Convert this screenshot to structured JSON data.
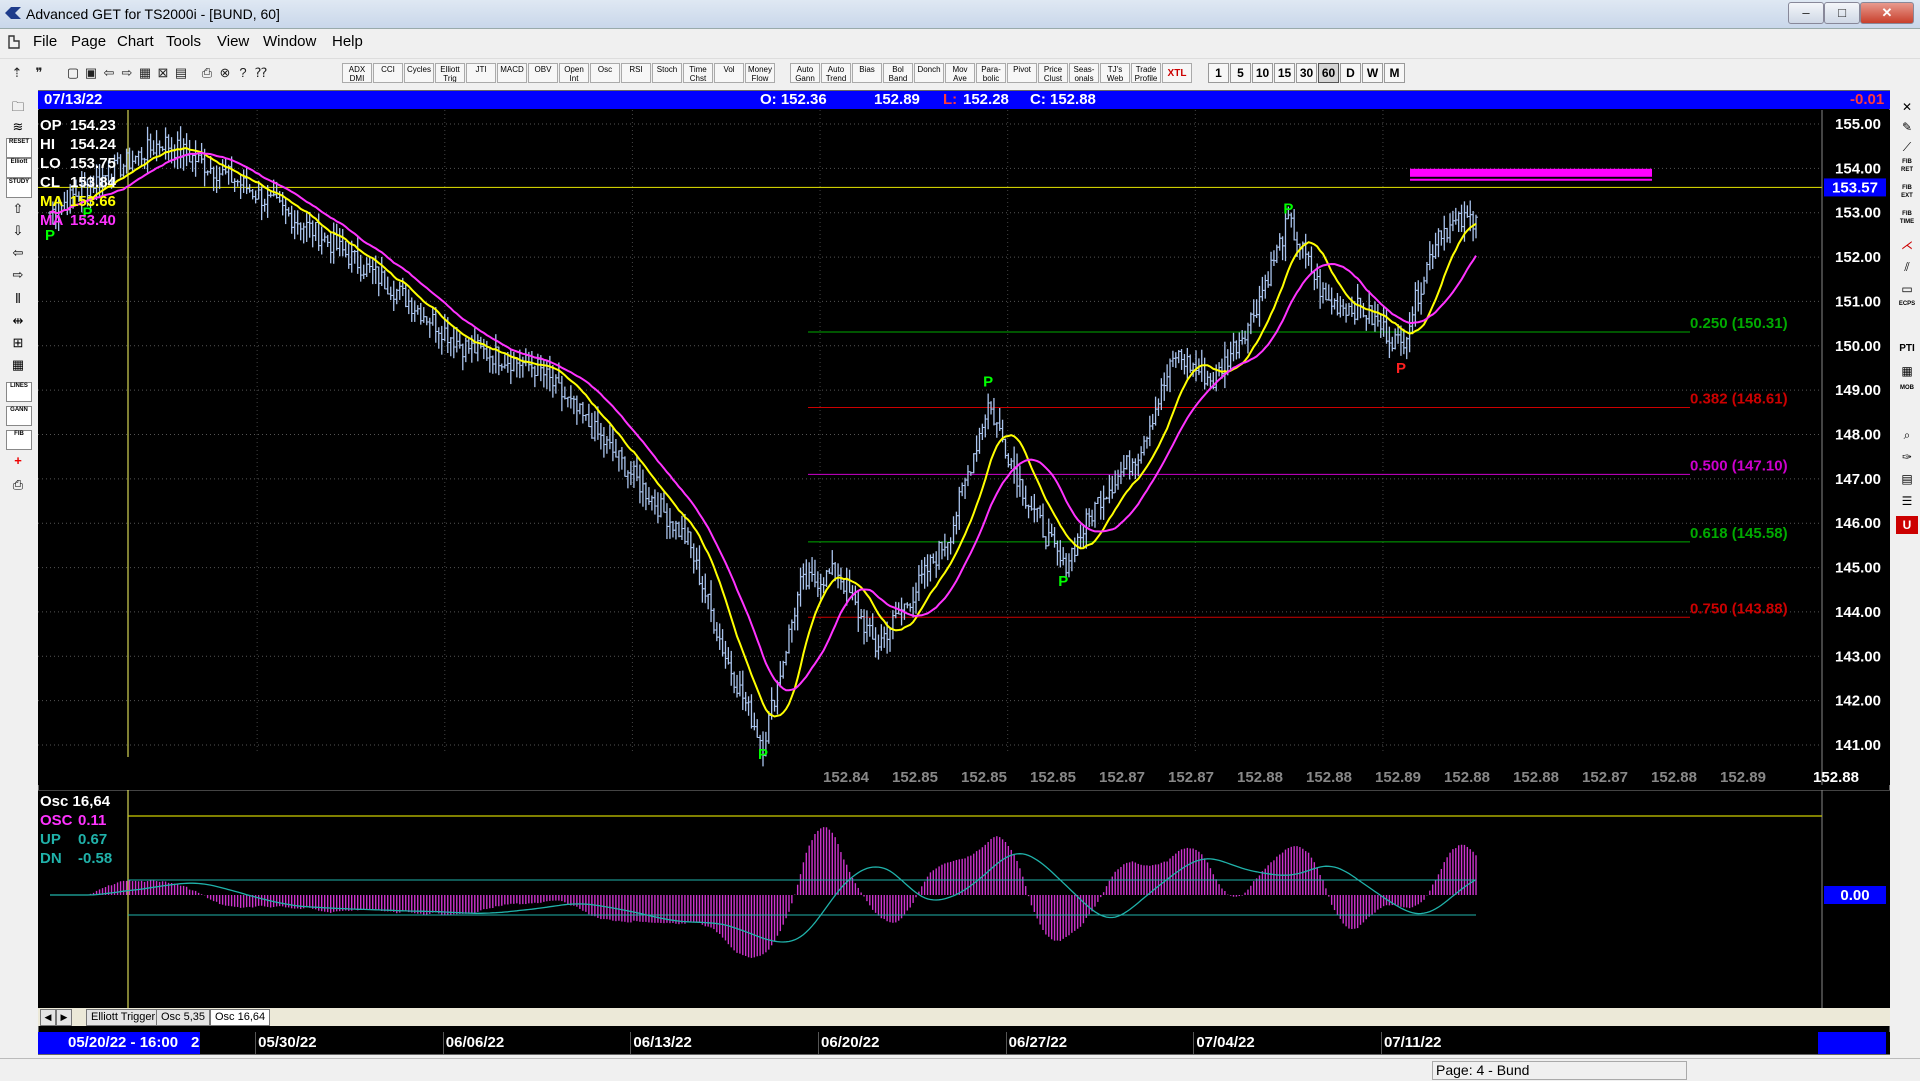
{
  "window": {
    "title": "Advanced GET for TS2000i - [BUND, 60]",
    "min": "–",
    "max": "□",
    "close": "✕"
  },
  "menu": [
    "File",
    "Page",
    "Chart",
    "Tools",
    "View",
    "Window",
    "Help"
  ],
  "toolbar": {
    "study_buttons": [
      "ADX DMI",
      "CCI",
      "Cycles",
      "Elliott Trig",
      "JTI",
      "MACD",
      "OBV",
      "Open Int",
      "Osc",
      "RSI",
      "Stoch",
      "Time Chst",
      "Vol",
      "Money Flow"
    ],
    "tool_buttons": [
      "Auto Gann",
      "Auto Trend",
      "Bias",
      "Bol Band",
      "Donch",
      "Mov Ave",
      "Para-bolic",
      "Pivot",
      "Price Clust",
      "Seas-onals",
      "TJ's Web",
      "Trade Profile",
      "XTL"
    ],
    "timeframes": [
      "1",
      "5",
      "10",
      "15",
      "30",
      "60",
      "D",
      "W",
      "M"
    ],
    "selected_timeframe": "60"
  },
  "left_tools": [
    "RESET",
    "Elliott",
    "STUDY",
    "LINES",
    "GANN",
    "FIB"
  ],
  "right_tools": [
    "FIB RET",
    "FIB EXT",
    "FIB TIME",
    "ECPS",
    "PTI",
    "MOB"
  ],
  "infobar": {
    "date": "07/13/22",
    "open": "O: 152.36",
    "high": "152.89",
    "low_label": "L:",
    "low": "152.28",
    "close": "C: 152.88",
    "change": "-0.01"
  },
  "legend": [
    {
      "label": "OP",
      "value": "154.23",
      "color": "#ffffff"
    },
    {
      "label": "HI",
      "value": "154.24",
      "color": "#ffffff"
    },
    {
      "label": "LO",
      "value": "153.75",
      "color": "#ffffff"
    },
    {
      "label": "CL",
      "value": "153.84",
      "color": "#ffffff"
    },
    {
      "label": "MA",
      "value": "153.66",
      "color": "#ffff00"
    },
    {
      "label": "MA",
      "value": "153.40",
      "color": "#ff33ff"
    }
  ],
  "osc_legend": [
    {
      "label": "Osc 16,64",
      "value": "",
      "color": "#ffffff"
    },
    {
      "label": "OSC",
      "value": "0.11",
      "color": "#ff33ff"
    },
    {
      "label": "UP",
      "value": "0.67",
      "color": "#20b2aa"
    },
    {
      "label": "DN",
      "value": "-0.58",
      "color": "#20b2aa"
    }
  ],
  "chart_data": {
    "type": "candlestick",
    "price_axis": {
      "min": 141.0,
      "max": 155.0,
      "ticks": [
        "155.00",
        "154.00",
        "153.00",
        "152.00",
        "151.00",
        "150.00",
        "149.00",
        "148.00",
        "147.00",
        "146.00",
        "145.00",
        "144.00",
        "143.00",
        "142.00",
        "141.00"
      ]
    },
    "current_price_marker": "153.57",
    "last_price": "152.88",
    "bottom_price_labels": [
      "152.84",
      "152.85",
      "152.85",
      "152.85",
      "152.87",
      "152.87",
      "152.88",
      "152.88",
      "152.89",
      "152.88",
      "152.88",
      "152.87",
      "152.88",
      "152.89"
    ],
    "fib_levels": [
      {
        "label": "0.250 (150.31)",
        "price": 150.31,
        "color": "#00aa00"
      },
      {
        "label": "0.382 (148.61)",
        "price": 148.61,
        "color": "#cc0000"
      },
      {
        "label": "0.500 (147.10)",
        "price": 147.1,
        "color": "#cc00cc"
      },
      {
        "label": "0.618 (145.58)",
        "price": 145.58,
        "color": "#00aa00"
      },
      {
        "label": "0.750 (143.88)",
        "price": 143.88,
        "color": "#cc0000"
      }
    ],
    "horizontal_line": 153.57,
    "projection_box": {
      "price": 153.9,
      "color": "#ff00ff"
    },
    "price_path": [
      {
        "date": "05/20",
        "price": 153.0
      },
      {
        "date": "05/23",
        "price": 153.6
      },
      {
        "date": "05/25",
        "price": 154.6
      },
      {
        "date": "05/27",
        "price": 153.7
      },
      {
        "date": "05/31",
        "price": 152.6
      },
      {
        "date": "06/02",
        "price": 151.4
      },
      {
        "date": "06/06",
        "price": 150.0
      },
      {
        "date": "06/08",
        "price": 149.5
      },
      {
        "date": "06/10",
        "price": 147.6
      },
      {
        "date": "06/14",
        "price": 145.6
      },
      {
        "date": "06/15",
        "price": 143.0
      },
      {
        "date": "06/16",
        "price": 141.0
      },
      {
        "date": "06/17",
        "price": 144.6
      },
      {
        "date": "06/20",
        "price": 144.9
      },
      {
        "date": "06/21",
        "price": 143.2
      },
      {
        "date": "06/22",
        "price": 144.4
      },
      {
        "date": "06/23",
        "price": 145.8
      },
      {
        "date": "06/24",
        "price": 148.7
      },
      {
        "date": "06/27",
        "price": 146.6
      },
      {
        "date": "06/28",
        "price": 145.0
      },
      {
        "date": "06/29",
        "price": 146.6
      },
      {
        "date": "06/30",
        "price": 147.6
      },
      {
        "date": "07/01",
        "price": 149.8
      },
      {
        "date": "07/04",
        "price": 149.2
      },
      {
        "date": "07/05",
        "price": 150.6
      },
      {
        "date": "07/06",
        "price": 152.8
      },
      {
        "date": "07/07",
        "price": 151.0
      },
      {
        "date": "07/08",
        "price": 150.8
      },
      {
        "date": "07/11",
        "price": 150.0
      },
      {
        "date": "07/12",
        "price": 152.6
      },
      {
        "date": "07/13",
        "price": 152.9
      }
    ],
    "pivots": [
      {
        "date": "05/20",
        "price": 152.5,
        "label": "P",
        "color": "#00ff00"
      },
      {
        "date": "05/23",
        "price": 153.0,
        "label": "P",
        "color": "#00ff00"
      },
      {
        "date": "06/16",
        "price": 140.8,
        "label": "P",
        "color": "#00ff00"
      },
      {
        "date": "06/24",
        "price": 149.2,
        "label": "P",
        "color": "#00ff00"
      },
      {
        "date": "06/28",
        "price": 144.7,
        "label": "P",
        "color": "#00ff00"
      },
      {
        "date": "07/06",
        "price": 153.1,
        "label": "P",
        "color": "#00ff00"
      },
      {
        "date": "07/11",
        "price": 149.5,
        "label": "P",
        "color": "#ff2020"
      }
    ],
    "date_axis": [
      "05/30/22",
      "06/06/22",
      "06/13/22",
      "06/20/22",
      "06/27/22",
      "07/04/22",
      "07/11/22"
    ],
    "cursor_date": "05/20/22 - 16:00",
    "cursor_date_suffix": "2"
  },
  "osc_axis_value": "0.00",
  "tabs": [
    "Elliott Trigger",
    "Osc 5,35",
    "Osc 16,64"
  ],
  "active_tab": "Osc 16,64",
  "status": "Page: 4 - Bund"
}
